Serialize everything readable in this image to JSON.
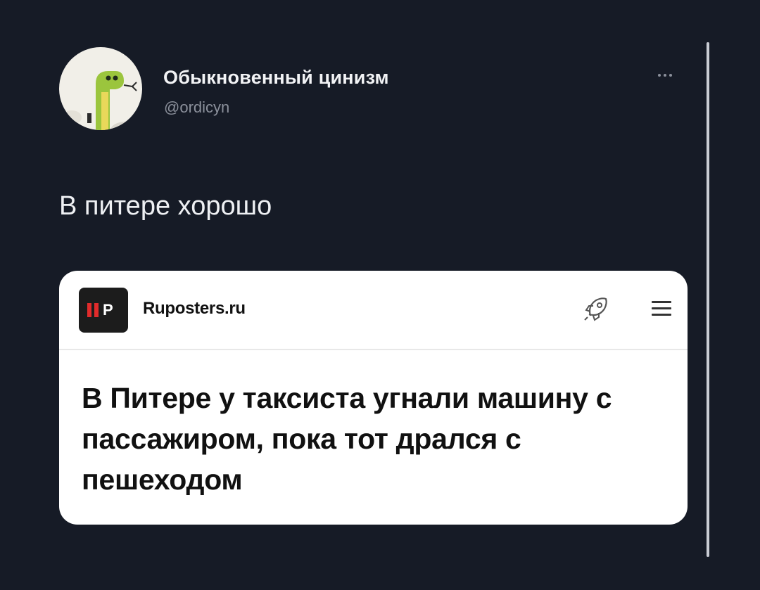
{
  "author": {
    "display_name": "Обыкновенный цинизм",
    "handle": "@ordicyn",
    "avatar_icon": "snake-avatar"
  },
  "tweet": {
    "text": "В питере хорошо"
  },
  "card": {
    "site_logo_text": "RP",
    "site_name": "Ruposters.ru",
    "headline": "В Питере у таксиста угнали машину с пассажиром, пока тот дрался с пешеходом",
    "icons": [
      "rocket-icon",
      "menu-icon"
    ]
  },
  "colors": {
    "background": "#161b26",
    "card_background": "#ffffff",
    "logo_accent": "#e12b2b"
  }
}
